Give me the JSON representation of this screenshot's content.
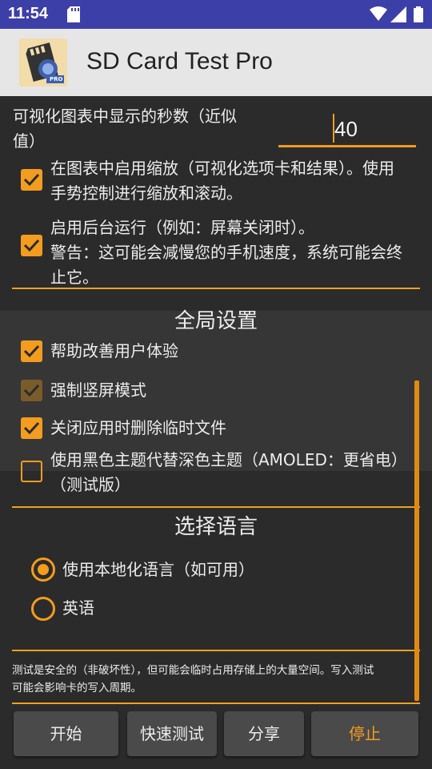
{
  "status_bar": {
    "time": "11:54",
    "icons": [
      "sd-card-icon",
      "wifi-icon",
      "signal-icon",
      "battery-icon"
    ]
  },
  "app_bar": {
    "title": "SD Card Test Pro",
    "logo_badge": "PRO"
  },
  "settings": {
    "seconds_label": "可视化图表中显示的秒数（近似值）",
    "seconds_label_line1": "可视化图表中显示的秒数（近似",
    "seconds_label_line2": "值）",
    "seconds_value": "40",
    "zoom": {
      "line1": "在图表中启用缩放（可视化选项卡和结果）。使用",
      "line2": "手势控制进行缩放和滚动。",
      "checked": true
    },
    "background": {
      "line1": "启用后台运行（例如：屏幕关闭时）。",
      "line2": "警告：这可能会减慢您的手机速度，系统可能会终",
      "line3": "止它。",
      "checked": true
    }
  },
  "global": {
    "title": "全局设置",
    "items": [
      {
        "label": "帮助改善用户体验",
        "checked": true,
        "enabled": true
      },
      {
        "label": "强制竖屏模式",
        "checked": true,
        "enabled": false
      },
      {
        "label": "关闭应用时删除临时文件",
        "checked": true,
        "enabled": true
      },
      {
        "label_line1": "使用黑色主题代替深色主题（AMOLED：更省电）",
        "label_line2": "（测试版）",
        "checked": false,
        "enabled": true
      }
    ]
  },
  "language": {
    "title": "选择语言",
    "options": [
      {
        "label": "使用本地化语言（如可用）",
        "selected": true
      },
      {
        "label": "英语",
        "selected": false
      }
    ]
  },
  "notice": {
    "line1": "测试是安全的（非破坏性），但可能会临时占用存储上的大量空间。写入测试",
    "line2": "可能会影响卡的写入周期。"
  },
  "buttons": {
    "start": "开始",
    "quick_test": "快速测试",
    "share": "分享",
    "stop": "停止"
  },
  "colors": {
    "accent": "#f39c1e",
    "status_bar": "#3c3fa8",
    "app_bar": "#e6e6e6",
    "background": "#2b2b2b"
  }
}
